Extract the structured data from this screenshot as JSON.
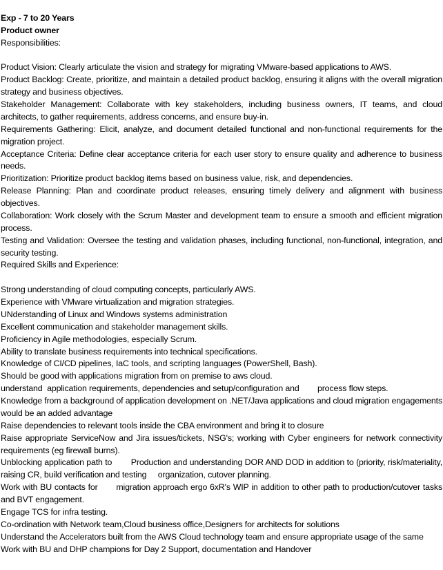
{
  "header": {
    "experience": "Exp - 7 to 20 Years",
    "role": "Product owner",
    "responsibilities_heading": "Responsibilities:"
  },
  "responsibilities": [
    "Product Vision: Clearly articulate the vision and strategy for migrating VMware-based applications to AWS.",
    "Product Backlog: Create, prioritize, and maintain a detailed product backlog, ensuring it aligns with the overall migration strategy and business objectives.",
    "Stakeholder Management: Collaborate with key stakeholders, including business owners, IT teams, and cloud architects, to gather requirements, address concerns, and ensure buy-in.",
    "Requirements Gathering: Elicit, analyze, and document detailed functional and non-functional requirements for the migration project.",
    "Acceptance Criteria: Define clear acceptance criteria for each user story to ensure quality and adherence to business needs.",
    "Prioritization: Prioritize product backlog items based on business value, risk, and dependencies.",
    "Release Planning: Plan and coordinate product releases, ensuring timely delivery and alignment with business objectives.",
    "Collaboration: Work closely with the Scrum Master and development team to ensure a smooth and efficient migration process.",
    "Testing and Validation: Oversee the testing and validation phases, including functional, non-functional, integration, and security testing."
  ],
  "skills_heading": "Required Skills and Experience:",
  "skills": [
    "Strong understanding of cloud computing concepts, particularly AWS.",
    "Experience with VMware virtualization and migration strategies.",
    "UNderstanding of Linux and Windows systems administration",
    "Excellent communication and stakeholder management skills.",
    "Proficiency in Agile methodologies, especially Scrum.",
    "Ability to translate business requirements into technical specifications.",
    "Knowledge of CI/CD pipelines, IaC tools, and scripting languages (PowerShell, Bash).",
    "Should be good with applications migration from on premise to aws cloud.",
    "understand  application requirements, dependencies and setup/configuration and        process flow steps.",
    "Knowledge from a background of application development on .NET/Java applications and cloud migration engagements would be an added advantage",
    "Raise dependencies to relevant tools inside the CBA environment and bring it to closure",
    "Raise appropriate ServiceNow and Jira issues/tickets, NSG's; working with Cyber engineers for network connectivity requirements (eg firewall burns).",
    "Unblocking application path to        Production and understanding DOR AND DOD in addition to (priority, risk/materiality, raising CR, build verification and testing     organization, cutover planning.",
    "Work with BU contacts for       migration approach ergo 6xR's WIP in addition to other path to production/cutover tasks and BVT engagement.",
    "Engage TCS for infra testing.",
    "Co-ordination with Network team,Cloud business office,Designers for architects for solutions",
    "Understand the Accelerators built from the AWS Cloud technology team and ensure appropriate usage of the same",
    "Work with BU and DHP champions for Day 2 Support, documentation and Handover"
  ]
}
